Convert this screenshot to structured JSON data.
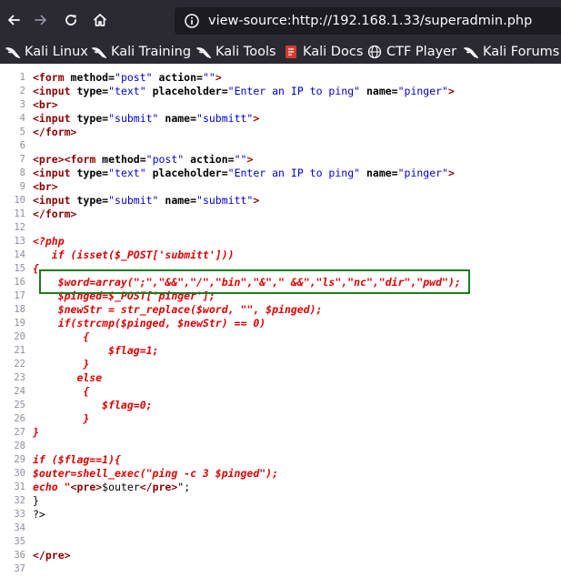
{
  "browser": {
    "url": "view-source:http://192.168.1.33/superadmin.php",
    "icons": {
      "back": "arrow-left-icon",
      "forward": "arrow-right-icon",
      "reload": "reload-icon",
      "home": "home-icon",
      "info": "info-icon"
    }
  },
  "bookmarks": [
    {
      "label": "Kali Linux",
      "icon": "kali-dragon-icon"
    },
    {
      "label": "Kali Training",
      "icon": "kali-dragon-icon"
    },
    {
      "label": "Kali Tools",
      "icon": "kali-dragon-icon"
    },
    {
      "label": "Kali Docs",
      "icon": "kali-docs-icon"
    },
    {
      "label": "CTF Player",
      "icon": "globe-icon"
    },
    {
      "label": "Kali Forums",
      "icon": "kali-dragon-icon"
    }
  ],
  "source_lines": [
    {
      "n": "1",
      "seg": [
        [
          "tag",
          "<form "
        ],
        [
          "attr",
          "method="
        ],
        [
          "val",
          "\"post\" "
        ],
        [
          "attr",
          "action="
        ],
        [
          "val",
          "\"\""
        ],
        [
          "tag",
          ">"
        ]
      ]
    },
    {
      "n": "2",
      "seg": [
        [
          "tag",
          "<input "
        ],
        [
          "attr",
          "type="
        ],
        [
          "val",
          "\"text\" "
        ],
        [
          "attr",
          "placeholder="
        ],
        [
          "val",
          "\"Enter an IP to ping\" "
        ],
        [
          "attr",
          "name="
        ],
        [
          "val",
          "\"pinger\""
        ],
        [
          "tag",
          ">"
        ]
      ]
    },
    {
      "n": "3",
      "seg": [
        [
          "tag",
          "<br>"
        ]
      ]
    },
    {
      "n": "4",
      "seg": [
        [
          "tag",
          "<input "
        ],
        [
          "attr",
          "type="
        ],
        [
          "val",
          "\"submit\" "
        ],
        [
          "attr",
          "name="
        ],
        [
          "val",
          "\"submitt\""
        ],
        [
          "tag",
          ">"
        ]
      ]
    },
    {
      "n": "5",
      "seg": [
        [
          "tag",
          "</form>"
        ]
      ]
    },
    {
      "n": "6",
      "seg": []
    },
    {
      "n": "7",
      "seg": [
        [
          "tag",
          "<pre>"
        ],
        [
          "tag",
          "<form "
        ],
        [
          "attr",
          "method="
        ],
        [
          "val",
          "\"post\" "
        ],
        [
          "attr",
          "action="
        ],
        [
          "val",
          "\"\""
        ],
        [
          "tag",
          ">"
        ]
      ]
    },
    {
      "n": "8",
      "seg": [
        [
          "tag",
          "<input "
        ],
        [
          "attr",
          "type="
        ],
        [
          "val",
          "\"text\" "
        ],
        [
          "attr",
          "placeholder="
        ],
        [
          "val",
          "\"Enter an IP to ping\" "
        ],
        [
          "attr",
          "name="
        ],
        [
          "val",
          "\"pinger\""
        ],
        [
          "tag",
          ">"
        ]
      ]
    },
    {
      "n": "9",
      "seg": [
        [
          "tag",
          "<br>"
        ]
      ]
    },
    {
      "n": "10",
      "seg": [
        [
          "tag",
          "<input "
        ],
        [
          "attr",
          "type="
        ],
        [
          "val",
          "\"submit\" "
        ],
        [
          "attr",
          "name="
        ],
        [
          "val",
          "\"submitt\""
        ],
        [
          "tag",
          ">"
        ]
      ]
    },
    {
      "n": "11",
      "seg": [
        [
          "tag",
          "</form>"
        ]
      ]
    },
    {
      "n": "12",
      "seg": []
    },
    {
      "n": "13",
      "seg": [
        [
          "php",
          "<?php"
        ]
      ]
    },
    {
      "n": "14",
      "seg": [
        [
          "php",
          "   if (isset($_POST['submitt']))"
        ]
      ]
    },
    {
      "n": "15",
      "seg": [
        [
          "php",
          "{"
        ]
      ]
    },
    {
      "n": "16",
      "seg": [
        [
          "php",
          "    $word=array(\";\",\"&&\",\"/\",\"bin\",\"&\",\" &&\",\"ls\",\"nc\",\"dir\",\"pwd\");"
        ]
      ]
    },
    {
      "n": "17",
      "seg": [
        [
          "php",
          "    $pinged=$_POST['pinger'];"
        ]
      ]
    },
    {
      "n": "18",
      "seg": [
        [
          "php",
          "    $newStr = str_replace($word, \"\", $pinged);"
        ]
      ]
    },
    {
      "n": "19",
      "seg": [
        [
          "php",
          "    if(strcmp($pinged, $newStr) == 0)"
        ]
      ]
    },
    {
      "n": "20",
      "seg": [
        [
          "php",
          "        {"
        ]
      ]
    },
    {
      "n": "21",
      "seg": [
        [
          "php",
          "            $flag=1;"
        ]
      ]
    },
    {
      "n": "22",
      "seg": [
        [
          "php",
          "        }"
        ]
      ]
    },
    {
      "n": "23",
      "seg": [
        [
          "php",
          "       else"
        ]
      ]
    },
    {
      "n": "24",
      "seg": [
        [
          "php",
          "        {"
        ]
      ]
    },
    {
      "n": "25",
      "seg": [
        [
          "php",
          "           $flag=0;"
        ]
      ]
    },
    {
      "n": "26",
      "seg": [
        [
          "php",
          "        }"
        ]
      ]
    },
    {
      "n": "27",
      "seg": [
        [
          "php",
          "}"
        ]
      ]
    },
    {
      "n": "28",
      "seg": []
    },
    {
      "n": "29",
      "seg": [
        [
          "php",
          "if ($flag==1){"
        ]
      ]
    },
    {
      "n": "30",
      "seg": [
        [
          "php",
          "$outer=shell_exec(\"ping -c 3 $pinged\");"
        ]
      ]
    },
    {
      "n": "31",
      "seg": [
        [
          "php",
          "echo \""
        ],
        [
          "tag",
          "<pre>"
        ],
        [
          "plain",
          "$outer"
        ],
        [
          "tag",
          "</pre>"
        ],
        [
          "plain",
          "\";"
        ]
      ]
    },
    {
      "n": "32",
      "seg": [
        [
          "plain",
          "}"
        ]
      ]
    },
    {
      "n": "33",
      "seg": [
        [
          "plain",
          "?>"
        ]
      ]
    },
    {
      "n": "34",
      "seg": []
    },
    {
      "n": "35",
      "seg": []
    },
    {
      "n": "36",
      "seg": [
        [
          "tag",
          "</pre>"
        ]
      ]
    },
    {
      "n": "37",
      "seg": []
    }
  ]
}
